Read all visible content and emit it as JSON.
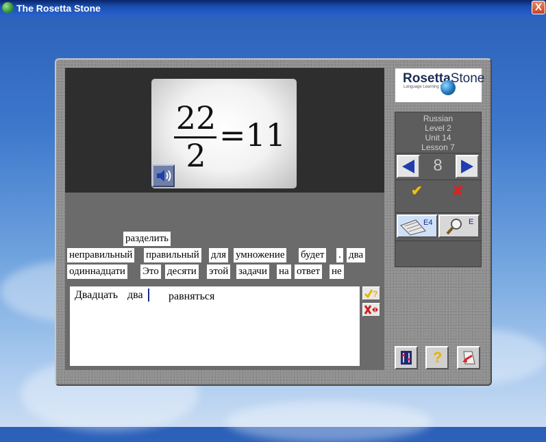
{
  "window": {
    "title": "The Rosetta Stone",
    "close_glyph": "X"
  },
  "image": {
    "numerator": "22",
    "denominator": "2",
    "rest": "=11"
  },
  "word_bank": {
    "row1": [
      "разделить"
    ],
    "row2": [
      "неправильный",
      "правильный",
      "для",
      "умножение",
      "будет",
      ".",
      "два"
    ],
    "row3": [
      "одиннадцати",
      "Это",
      "десяти",
      "этой",
      "задачи",
      "на",
      "ответ",
      "не"
    ]
  },
  "answer": {
    "word1": "Двадцать",
    "word2": "два",
    "word3": "равняться"
  },
  "logo": {
    "name_a": "Rosetta",
    "name_b": "Stone",
    "tagline": "Language Learning Success"
  },
  "lesson_info": {
    "language": "Russian",
    "level": "Level 2",
    "unit": "Unit 14",
    "lesson": "Lesson 7"
  },
  "navigation": {
    "screen_number": "8"
  },
  "marks": {
    "check": "✔",
    "cross": "✘"
  },
  "tools": {
    "keyboard_label": "E4",
    "magnifier_label": "E"
  },
  "bottom": {
    "help_glyph": "?"
  },
  "colors": {
    "check": "#f2c200",
    "cross": "#e02020",
    "nav_arrow": "#1f3fb0"
  }
}
